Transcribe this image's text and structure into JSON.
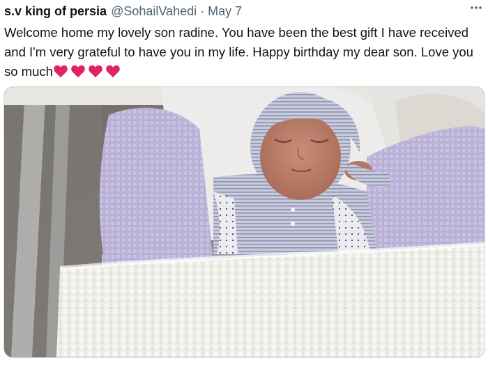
{
  "tweet": {
    "display_name": "s.v king of persia",
    "handle": "@SohailVahedi",
    "separator": "·",
    "date": "May 7",
    "more_icon": "more-horizontal-icon",
    "text": "Welcome home my lovely son radine. You have been the best gift I have received and I'm very grateful to have you in my life. Happy birthday my dear son. Love you so much",
    "emoji": [
      "red-heart",
      "red-heart",
      "red-heart",
      "red-heart"
    ],
    "heart_color": "#e0245e"
  },
  "media": {
    "type": "photo",
    "alt": ""
  }
}
